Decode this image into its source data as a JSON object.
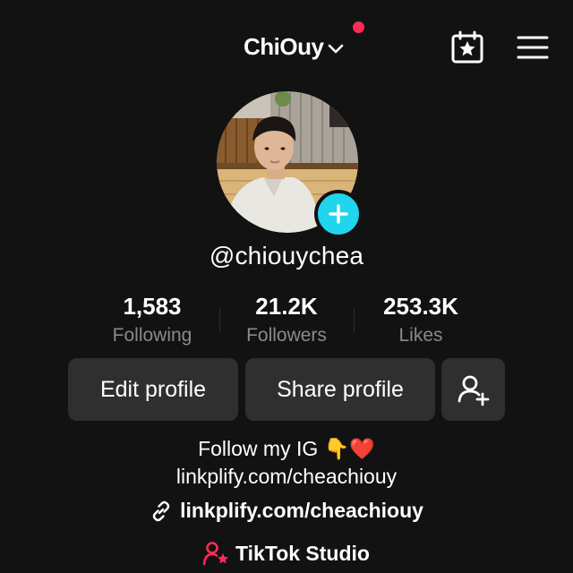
{
  "header": {
    "account_name": "ChiOuy",
    "icons": {
      "switch": "chevron-down-icon",
      "calendar": "calendar-star-icon",
      "menu": "hamburger-menu-icon"
    },
    "notification_color": "#fe2c55"
  },
  "profile": {
    "username": "@chiouychea",
    "avatar_add_color": "#20d5ec"
  },
  "stats": [
    {
      "value": "1,583",
      "label": "Following"
    },
    {
      "value": "21.2K",
      "label": "Followers"
    },
    {
      "value": "253.3K",
      "label": "Likes"
    }
  ],
  "actions": {
    "edit_label": "Edit profile",
    "share_label": "Share profile",
    "add_friend_icon": "add-friend-icon"
  },
  "bio": {
    "line1_text": "Follow my IG",
    "line1_emoji_point": "👇",
    "line1_emoji_heart": "❤️",
    "line2": "linkplify.com/cheachiouy"
  },
  "link": {
    "text": "linkplify.com/cheachiouy",
    "icon": "link-icon"
  },
  "studio": {
    "label": "TikTok Studio",
    "icon": "creator-star-icon",
    "icon_color": "#fe2c55"
  }
}
